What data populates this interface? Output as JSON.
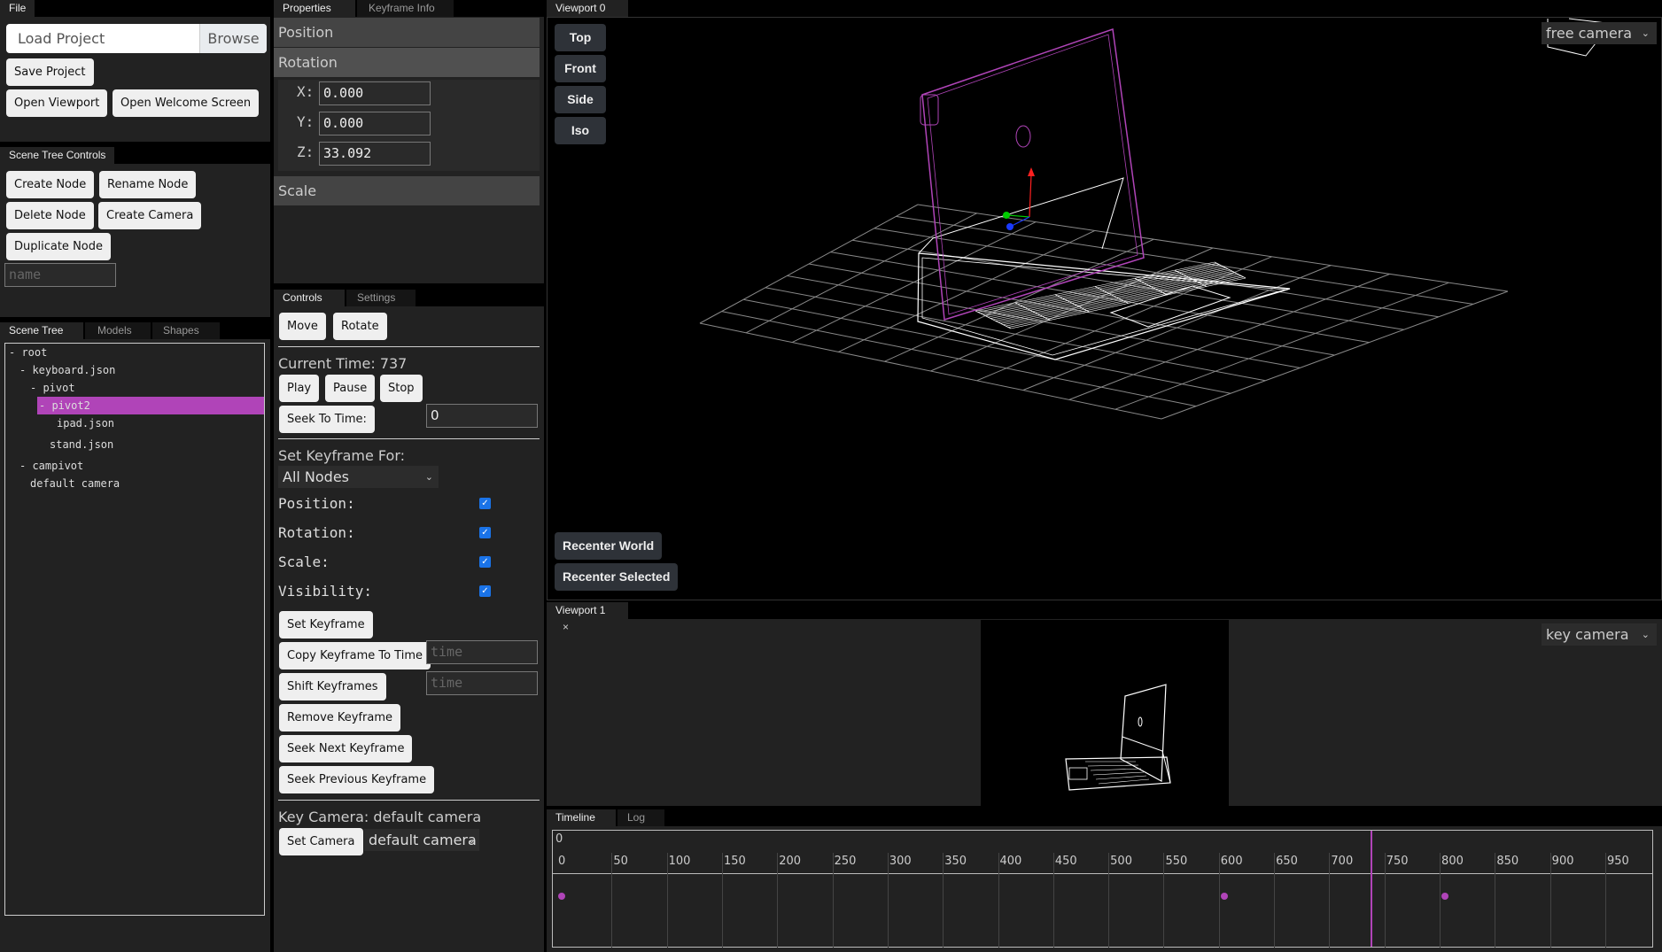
{
  "file_panel": {
    "tab": "File",
    "load_project_label": "Load Project",
    "browse_label": "Browse",
    "save_project": "Save Project",
    "open_viewport": "Open Viewport",
    "open_welcome": "Open Welcome Screen"
  },
  "scene_tree_controls": {
    "tab": "Scene Tree Controls",
    "create_node": "Create Node",
    "rename_node": "Rename Node",
    "delete_node": "Delete Node",
    "create_camera": "Create Camera",
    "duplicate_node": "Duplicate Node",
    "name_placeholder": "name"
  },
  "scene_tree": {
    "tabs": [
      "Scene Tree",
      "Models",
      "Shapes"
    ],
    "nodes": [
      {
        "label": "- root",
        "depth": 0,
        "selected": false
      },
      {
        "label": "- keyboard.json",
        "depth": 1,
        "selected": false
      },
      {
        "label": "- pivot",
        "depth": 2,
        "selected": false
      },
      {
        "label": "- pivot2",
        "depth": 3,
        "selected": true
      },
      {
        "label": "ipad.json",
        "depth": 4,
        "selected": false
      },
      {
        "label": "stand.json",
        "depth": 3,
        "selected": false
      },
      {
        "label": "- campivot",
        "depth": 1,
        "selected": false
      },
      {
        "label": "default camera",
        "depth": 2,
        "selected": false
      }
    ]
  },
  "properties": {
    "tabs": [
      "Properties",
      "Keyframe Info"
    ],
    "position_label": "Position",
    "rotation_label": "Rotation",
    "scale_label": "Scale",
    "rotation": {
      "x_label": "X:",
      "x": "0.000",
      "y_label": "Y:",
      "y": "0.000",
      "z_label": "Z:",
      "z": "33.092"
    }
  },
  "controls": {
    "tabs": [
      "Controls",
      "Settings"
    ],
    "move": "Move",
    "rotate": "Rotate",
    "current_time": "Current Time: 737",
    "play": "Play",
    "pause": "Pause",
    "stop": "Stop",
    "seek_to_time": "Seek To Time:",
    "seek_value": "0",
    "set_keyframe_for": "Set Keyframe For:",
    "keyframe_target": "All Nodes",
    "checks": [
      {
        "label": "Position:",
        "checked": true
      },
      {
        "label": "Rotation:",
        "checked": true
      },
      {
        "label": "Scale:",
        "checked": true
      },
      {
        "label": "Visibility:",
        "checked": true
      }
    ],
    "set_keyframe": "Set Keyframe",
    "copy_keyframe": "Copy Keyframe To Time",
    "shift_keyframes": "Shift Keyframes",
    "time_placeholder": "time",
    "remove_keyframe": "Remove Keyframe",
    "seek_next": "Seek Next Keyframe",
    "seek_prev": "Seek Previous Keyframe",
    "key_camera": "Key Camera: default camera",
    "set_camera": "Set Camera",
    "camera_option": "default camera",
    "chevron": "⌄"
  },
  "viewport0": {
    "tab": "Viewport 0",
    "views": [
      "Top",
      "Front",
      "Side",
      "Iso"
    ],
    "camera": "free camera",
    "recenter_world": "Recenter World",
    "recenter_selected": "Recenter Selected",
    "colors": {
      "selected": "#b044b8",
      "wire": "#ffffff",
      "grid": "#888888",
      "axis_x": "#00cc00",
      "axis_y": "#ff2020",
      "axis_z": "#1a3aff"
    }
  },
  "viewport1": {
    "tab": "Viewport 1",
    "close": "×",
    "camera": "key camera"
  },
  "timeline": {
    "tabs": [
      "Timeline",
      "Log"
    ],
    "current_frame_label": "0",
    "ticks": [
      "0",
      "50",
      "100",
      "150",
      "200",
      "250",
      "300",
      "350",
      "400",
      "450",
      "500",
      "550",
      "600",
      "650",
      "700",
      "750",
      "800",
      "850",
      "900",
      "950"
    ],
    "range": [
      0,
      1000
    ],
    "current_time": 737,
    "keyframes": [
      0,
      600,
      800
    ],
    "accent": "#b044b8"
  }
}
